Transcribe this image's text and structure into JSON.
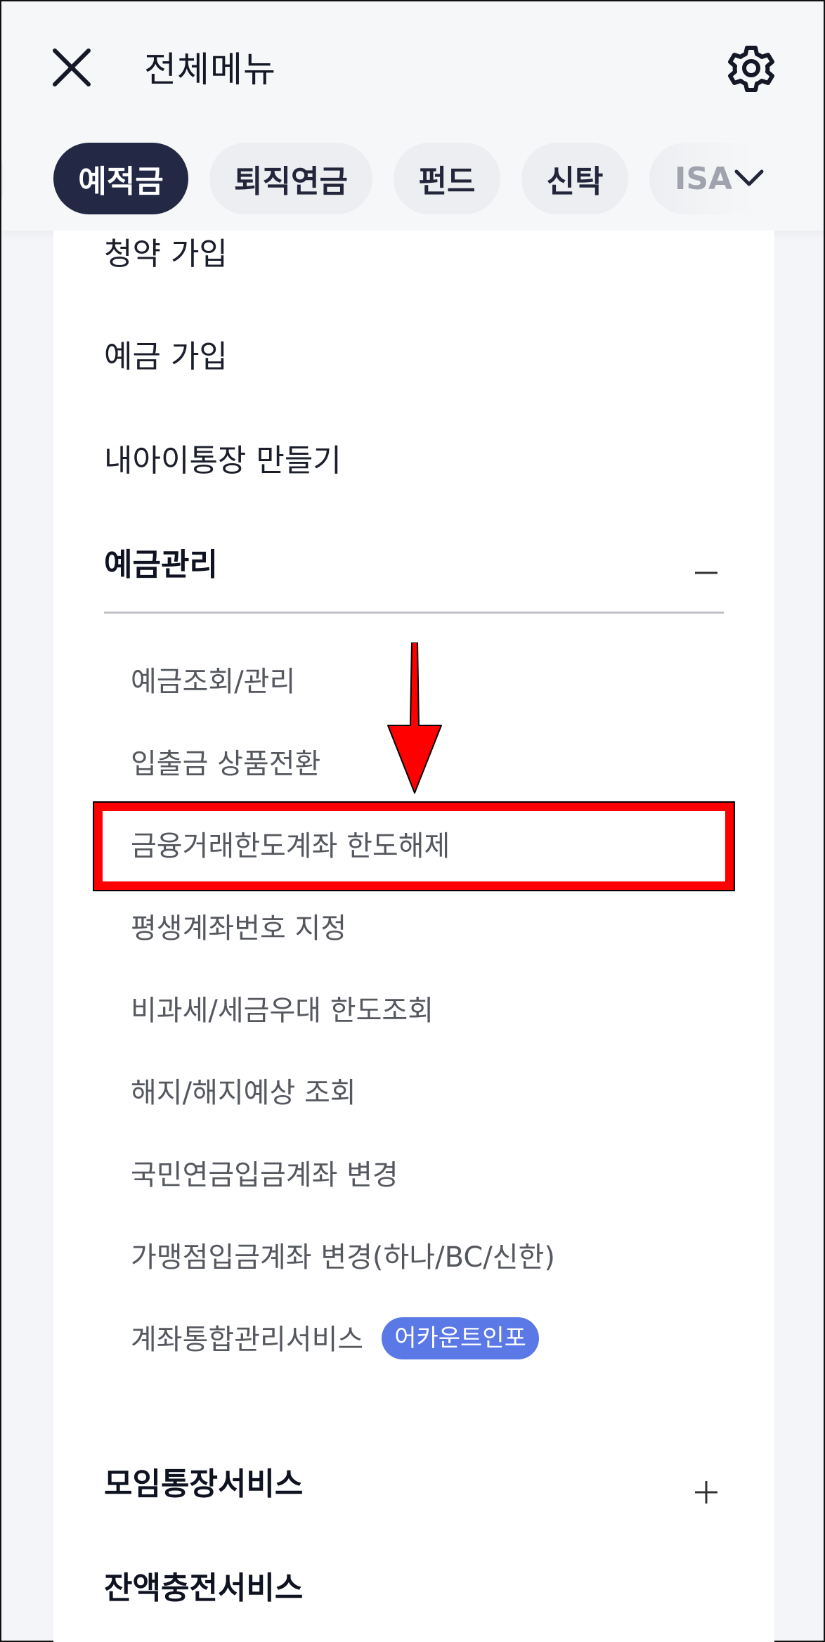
{
  "header": {
    "title": "전체메뉴",
    "close_icon": "close-icon",
    "settings_icon": "gear-icon"
  },
  "tabs": {
    "items": [
      {
        "label": "예적금",
        "active": true
      },
      {
        "label": "퇴직연금",
        "active": false
      },
      {
        "label": "펀드",
        "active": false
      },
      {
        "label": "신탁",
        "active": false
      },
      {
        "label": "ISA",
        "active": false
      }
    ],
    "expand_icon": "chevron-down-icon"
  },
  "menu": {
    "items": [
      "청약 가입",
      "예금 가입",
      "내아이통장 만들기"
    ],
    "section": {
      "title": "예금관리",
      "toggle_icon": "minus-icon",
      "sub_items": [
        "예금조회/관리",
        "입출금 상품전환",
        "금융거래한도계좌 한도해제",
        "평생계좌번호 지정",
        "비과세/세금우대 한도조회",
        "해지/해지예상 조회",
        "국민연금입금계좌 변경",
        "가맹점입금계좌 변경(하나/BC/신한)",
        "계좌통합관리서비스"
      ],
      "badge": "어카운트인포"
    },
    "collapsed_sections": [
      {
        "title": "모임통장서비스",
        "toggle_icon": "plus-icon"
      },
      {
        "title": "잔액충전서비스"
      }
    ]
  },
  "annotation": {
    "highlight_color": "#ff0000",
    "arrow_color": "#ff0000"
  },
  "colors": {
    "active_tab": "#232944",
    "badge": "#5a78e6"
  }
}
